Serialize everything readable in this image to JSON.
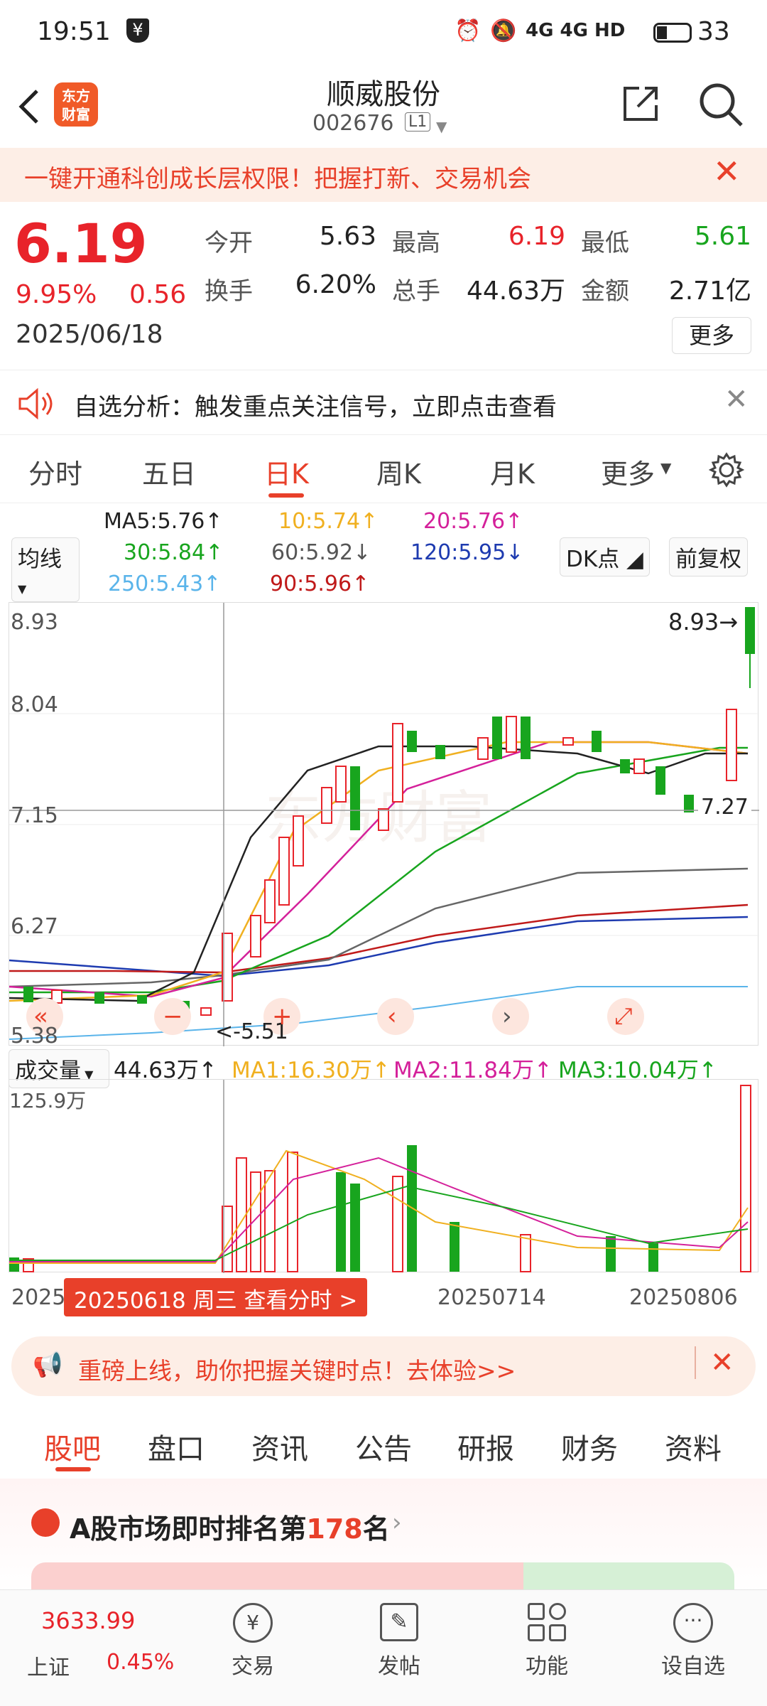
{
  "status": {
    "time": "19:51",
    "indicators": "4G 4G HD",
    "battery": "33"
  },
  "header": {
    "logo_line1": "东方",
    "logo_line2": "财富",
    "stock_name": "顺威股份",
    "stock_code": "002676",
    "level": "L1"
  },
  "banner": {
    "text": "一键开通科创成长层权限！把握打新、交易机会"
  },
  "quote": {
    "price": "6.19",
    "change_pct": "9.95%",
    "change": "0.56",
    "date": "2025/06/18",
    "open_label": "今开",
    "open": "5.63",
    "high_label": "最高",
    "high": "6.19",
    "low_label": "最低",
    "low": "5.61",
    "turnover_label": "换手",
    "turnover": "6.20%",
    "volume_label": "总手",
    "volume": "44.63万",
    "amount_label": "金额",
    "amount": "2.71亿",
    "more": "更多"
  },
  "notice": {
    "text": "自选分析：触发重点关注信号，立即点击查看"
  },
  "tabs": [
    "分时",
    "五日",
    "日K",
    "周K",
    "月K",
    "更多"
  ],
  "ma": {
    "selector": "均线",
    "ma5": "MA5:5.76↑",
    "ma10": "10:5.74↑",
    "ma20": "20:5.76↑",
    "ma30": "30:5.84↑",
    "ma60": "60:5.92↓",
    "ma120": "120:5.95↓",
    "ma250": "250:5.43↑",
    "ma90": "90:5.96↑",
    "dk": "DK点",
    "fq": "前复权"
  },
  "chart": {
    "y_labels": [
      "8.93",
      "8.04",
      "7.15",
      "6.27",
      "5.38"
    ],
    "hi_marker": "8.93→",
    "last_marker": "7.27",
    "low_marker": "<-5.51"
  },
  "volume": {
    "selector": "成交量",
    "value": "44.63万↑",
    "ma1": "MA1:16.30万↑",
    "ma2": "MA2:11.84万↑",
    "ma3": "MA3:10.04万↑",
    "max_label": "125.9万",
    "x_labels": [
      "2025",
      "20250714",
      "20250806"
    ],
    "tooltip": "20250618 周三 查看分时 >"
  },
  "promo": {
    "text": "重磅上线，助你把握关键时点！去体验>>"
  },
  "subtabs": [
    "股吧",
    "盘口",
    "资讯",
    "公告",
    "研报",
    "财务",
    "资料"
  ],
  "rank": {
    "prefix": "A股市场即时排名第",
    "number": "178",
    "suffix": "名"
  },
  "bottom": {
    "index_value": "3633.99",
    "index_name": "上证",
    "index_pct": "0.45%",
    "trade": "交易",
    "post": "发帖",
    "func": "功能",
    "watch": "设自选"
  },
  "colors": {
    "up": "#e8232a",
    "down": "#18a51e",
    "accent": "#e8402a"
  }
}
